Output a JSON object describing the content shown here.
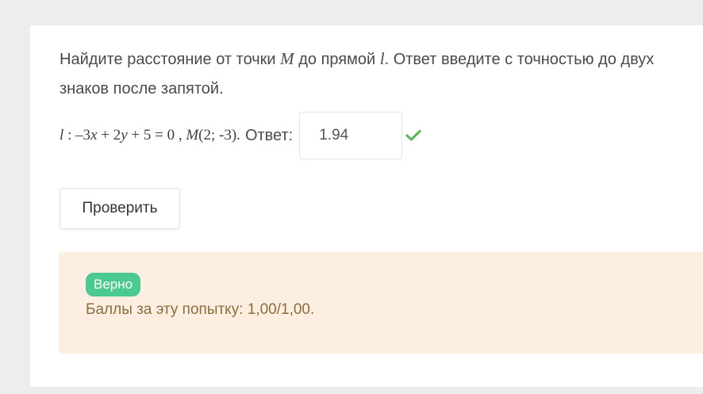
{
  "question": {
    "part1": "Найдите расстояние от точки ",
    "point": "M",
    "part2": " до прямой ",
    "line": "l",
    "part3": ". Ответ введите с точностью до двух знаков после запятой."
  },
  "formula": {
    "line_var": "l",
    "colon": " : –3",
    "x": "x",
    "plus2": " + 2",
    "y": "y",
    "rest": " + 5 = 0 , ",
    "point": "M",
    "coords": "(2; -3).",
    "answer_label": "Ответ:"
  },
  "answer": {
    "value": "1.94",
    "status_icon": "check-icon",
    "status_color": "#5cb85c"
  },
  "check_button": {
    "label": "Проверить"
  },
  "feedback": {
    "badge": "Верно",
    "badge_color": "#4cc990",
    "score_text": "Баллы за эту попытку: 1,00/1,00."
  }
}
